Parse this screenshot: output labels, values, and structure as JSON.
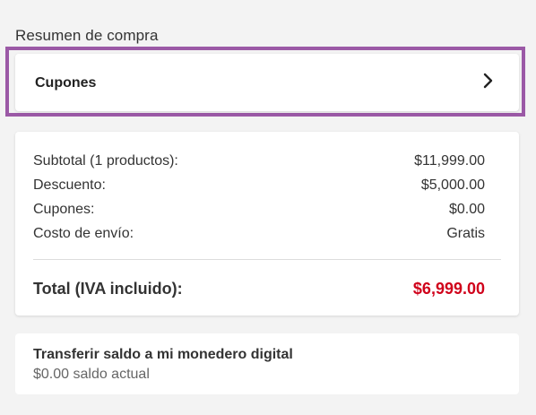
{
  "summary": {
    "title": "Resumen de compra"
  },
  "coupons": {
    "label": "Cupones",
    "icon": "chevron-right-icon",
    "highlight_color": "#9b59a6"
  },
  "breakdown": {
    "rows": [
      {
        "label": "Subtotal (1 productos):",
        "value": "$11,999.00"
      },
      {
        "label": "Descuento:",
        "value": "$5,000.00"
      },
      {
        "label": "Cupones:",
        "value": "$0.00"
      },
      {
        "label": "Costo de envío:",
        "value": "Gratis"
      }
    ],
    "total_label": "Total (IVA incluido):",
    "total_value": "$6,999.00",
    "total_color": "#d0021b"
  },
  "wallet": {
    "title": "Transferir saldo a mi monedero digital",
    "balance": "$0.00 saldo actual"
  }
}
